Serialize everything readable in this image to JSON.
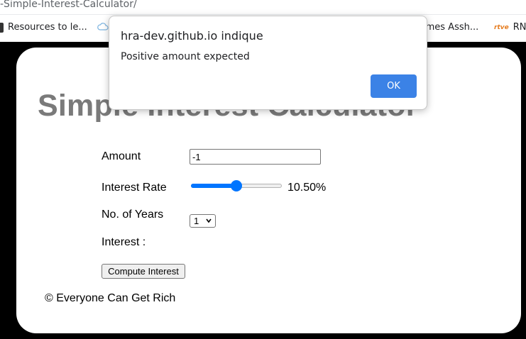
{
  "browser": {
    "url": "-Simple-Interest-Calculator/",
    "bookmarks": [
      {
        "label": "Resources to le...",
        "icon": "bookmark-dark-icon"
      },
      {
        "label": "",
        "icon": "cloud-icon"
      },
      {
        "label": "imes Assh...",
        "icon": ""
      },
      {
        "label": "RN",
        "icon": "rtve-icon"
      }
    ],
    "rtve_icon_text": "rtve"
  },
  "page": {
    "title": "Simple Interest Calculator",
    "amount": {
      "label": "Amount",
      "value": "-1"
    },
    "rate": {
      "label": "Interest Rate",
      "value_text": "10.50%",
      "value_fraction": 0.5
    },
    "years": {
      "label": "No. of Years",
      "selected": "1"
    },
    "interest_label": "Interest :",
    "compute_button": "Compute Interest",
    "footer": "© Everyone Can Get Rich"
  },
  "dialog": {
    "origin": "hra-dev.github.io indique",
    "message": "Positive amount expected",
    "ok_label": "OK"
  },
  "colors": {
    "accent": "#0075ff",
    "dialog_button": "#3b82e6",
    "title_gray": "#7a7a7a"
  }
}
